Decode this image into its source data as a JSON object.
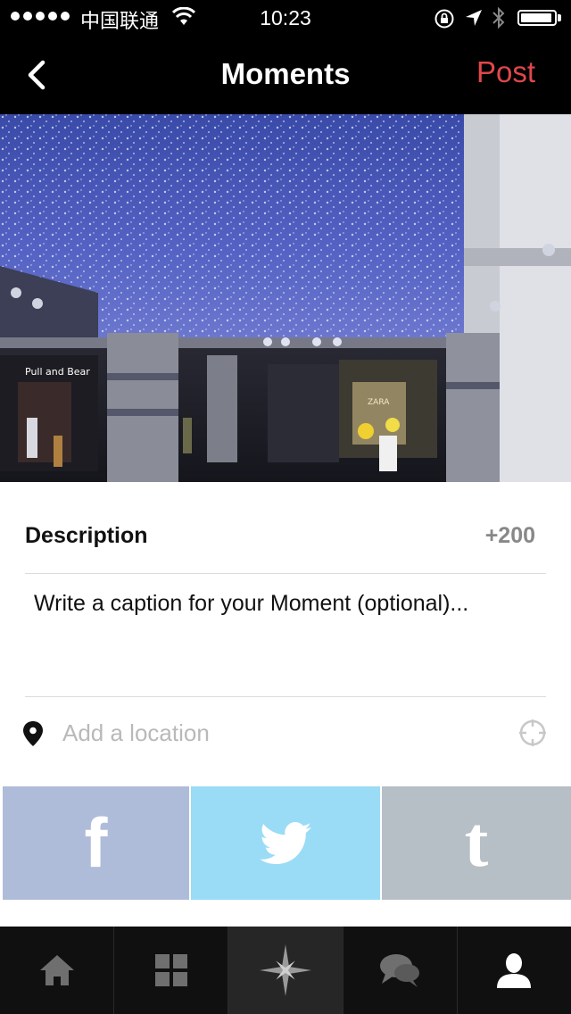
{
  "status_bar": {
    "carrier": "中国联通",
    "time": "10:23"
  },
  "nav": {
    "title": "Moments",
    "post_label": "Post"
  },
  "photo": {
    "description": "mall interior with blue light ceiling",
    "storefront_sign_left": "Pull and Bear",
    "storefront_sign_right": "ZARA"
  },
  "description": {
    "label": "Description",
    "counter": "+200",
    "caption_placeholder": "Write a caption for your Moment (optional)..."
  },
  "location": {
    "placeholder": "Add a location"
  },
  "share": {
    "facebook_glyph": "f",
    "tumblr_glyph": "t",
    "colors": {
      "facebook": "#afbcd9",
      "twitter": "#9adcf5",
      "tumblr": "#b6bec6"
    }
  },
  "tabbar": {
    "items": [
      "home-icon",
      "grid-icon",
      "compass-star-icon",
      "chat-icon",
      "profile-icon"
    ],
    "active_index": 2
  },
  "colors": {
    "accent": "#e0474c",
    "bar_background": "#000000"
  }
}
